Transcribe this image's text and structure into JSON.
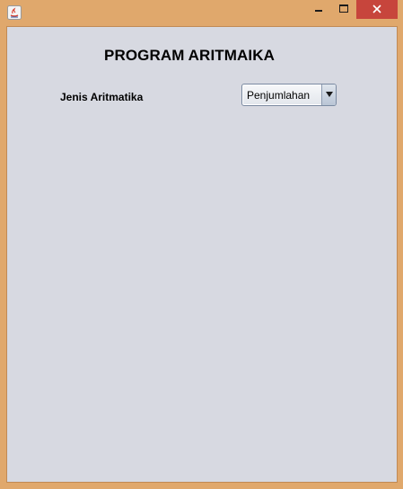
{
  "window": {
    "title": "",
    "colors": {
      "frame": "#e0a86c",
      "client": "#d7d9e1",
      "close_button": "#c7453c"
    },
    "icons": {
      "app": "java-icon",
      "minimize": "minimize-icon",
      "maximize": "maximize-icon",
      "close": "close-icon"
    }
  },
  "form": {
    "heading": "PROGRAM ARITMAIKA",
    "operation_label": "Jenis Aritmatika",
    "operation_select": {
      "selected": "Penjumlahan",
      "arrow_icon": "dropdown-arrow-icon"
    }
  }
}
